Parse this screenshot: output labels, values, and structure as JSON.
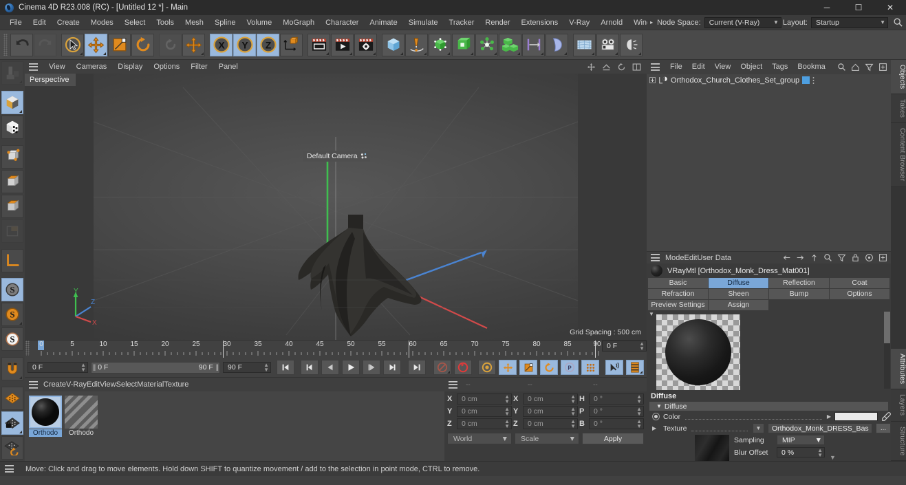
{
  "window": {
    "title": "Cinema 4D R23.008 (RC) - [Untitled 12 *] - Main",
    "minimize": "─",
    "maximize": "☐",
    "close": "✕"
  },
  "menubar": {
    "items": [
      "File",
      "Edit",
      "Create",
      "Modes",
      "Select",
      "Tools",
      "Mesh",
      "Spline",
      "Volume",
      "MoGraph",
      "Character",
      "Animate",
      "Simulate",
      "Tracker",
      "Render",
      "Extensions",
      "V-Ray",
      "Arnold",
      "Wind"
    ],
    "overflow_arrow": "▸",
    "node_space_label": "Node Space:",
    "node_space_value": "Current (V-Ray)",
    "layout_label": "Layout:",
    "layout_value": "Startup"
  },
  "viewport": {
    "menu": [
      "View",
      "Cameras",
      "Display",
      "Options",
      "Filter",
      "Panel"
    ],
    "perspective_label": "Perspective",
    "camera_label": "Default Camera",
    "grid_spacing": "Grid Spacing : 500 cm",
    "axis_x": "X",
    "axis_y": "Y",
    "axis_z": "Z"
  },
  "timeline": {
    "ruler_labels": [
      "0",
      "5",
      "10",
      "15",
      "20",
      "25",
      "30",
      "35",
      "40",
      "45",
      "50",
      "55",
      "60",
      "65",
      "70",
      "75",
      "80",
      "85",
      "90"
    ],
    "current_frame_right": "0 F",
    "start_field": "0 F",
    "range_start": "0 F",
    "range_end": "90 F",
    "end_field": "90 F"
  },
  "material_manager": {
    "menu": [
      "Create",
      "V-Ray",
      "Edit",
      "View",
      "Select",
      "Material",
      "Texture"
    ],
    "materials": [
      {
        "name": "Orthodo",
        "selected": true
      },
      {
        "name": "Orthodo",
        "selected": false
      }
    ]
  },
  "coordinates": {
    "headers": [
      "--",
      "--",
      "--"
    ],
    "rows": [
      {
        "pos_label": "X",
        "pos_value": "0 cm",
        "size_label": "X",
        "size_value": "0 cm",
        "rot_label": "H",
        "rot_value": "0 °"
      },
      {
        "pos_label": "Y",
        "pos_value": "0 cm",
        "size_label": "Y",
        "size_value": "0 cm",
        "rot_label": "P",
        "rot_value": "0 °"
      },
      {
        "pos_label": "Z",
        "pos_value": "0 cm",
        "size_label": "Z",
        "size_value": "0 cm",
        "rot_label": "B",
        "rot_value": "0 °"
      }
    ],
    "world_select": "World",
    "scale_select": "Scale",
    "apply_button": "Apply"
  },
  "object_manager": {
    "menu": [
      "File",
      "Edit",
      "View",
      "Object",
      "Tags",
      "Bookmarks"
    ],
    "object_name": "Orthodox_Church_Clothes_Set_group"
  },
  "attribute_manager": {
    "menu": [
      "Mode",
      "Edit",
      "User Data"
    ],
    "material_title": "VRayMtl [Orthodox_Monk_Dress_Mat001]",
    "tabs": [
      {
        "label": "Basic",
        "selected": false
      },
      {
        "label": "Diffuse",
        "selected": true
      },
      {
        "label": "Reflection",
        "selected": false
      },
      {
        "label": "Coat",
        "selected": false
      },
      {
        "label": "Refraction",
        "selected": false
      },
      {
        "label": "Sheen",
        "selected": false
      },
      {
        "label": "Bump",
        "selected": false
      },
      {
        "label": "Options",
        "selected": false
      },
      {
        "label": "Preview Settings",
        "selected": false
      },
      {
        "label": "Assign",
        "selected": false
      }
    ],
    "section_title": "Diffuse",
    "group_title": "Diffuse",
    "color_label": "Color",
    "color_value": "#e9e9e9",
    "texture_label": "Texture",
    "texture_value": "Orthodox_Monk_DRESS_Bas",
    "texture_browse": "...",
    "sampling_label": "Sampling",
    "sampling_value": "MIP",
    "blur_offset_label": "Blur Offset",
    "blur_offset_value": "0 %"
  },
  "right_tabs": [
    {
      "label": "Objects",
      "selected": true
    },
    {
      "label": "Takes",
      "selected": false
    },
    {
      "label": "Content Browser",
      "selected": false
    },
    {
      "label": "Attributes",
      "selected": true
    },
    {
      "label": "Layers",
      "selected": false
    },
    {
      "label": "Structure",
      "selected": false
    }
  ],
  "statusbar": {
    "message": "Move: Click and drag to move elements. Hold down SHIFT to quantize movement / add to the selection in point mode, CTRL to remove."
  },
  "colors": {
    "accent_blue": "#7aa7d8",
    "orange": "#e08a1e",
    "panel_bg": "#3b3b3b",
    "toolbar_bg": "#4a4a4a"
  }
}
